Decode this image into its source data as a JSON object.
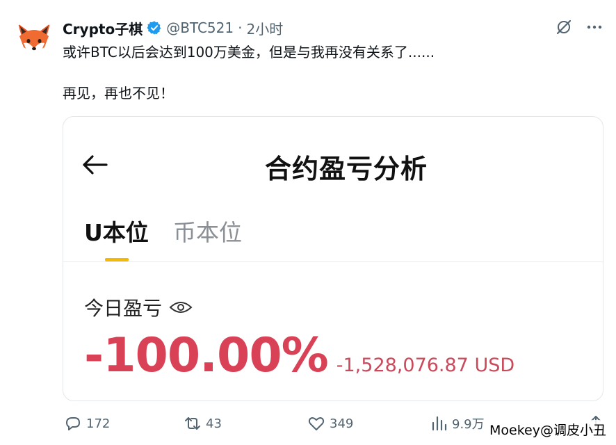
{
  "author": {
    "display_name": "Crypto子棋",
    "handle": "@BTC521",
    "separator": "·",
    "time": "2小时",
    "avatar_icon": "fox-avatar-icon",
    "verified_color": "#1d9bf0"
  },
  "tweet": {
    "line1": "或许BTC以后会达到100万美金，但是与我再没有关系了......",
    "line2": "再见，再也不见！"
  },
  "media": {
    "screen_title": "合约盈亏分析",
    "tabs": [
      "U本位",
      "币本位"
    ],
    "active_tab": "U本位",
    "tab_indicator_color": "#f0b90b",
    "today_label": "今日盈亏",
    "pnl_percent": "-100.00%",
    "pnl_amount": "-1,528,076.87 USD",
    "loss_color": "#d94256"
  },
  "actions": {
    "reply_count": "172",
    "retweet_count": "43",
    "like_count": "349",
    "view_count": "9.9万"
  },
  "watermark": "Moekey@调皮小丑"
}
